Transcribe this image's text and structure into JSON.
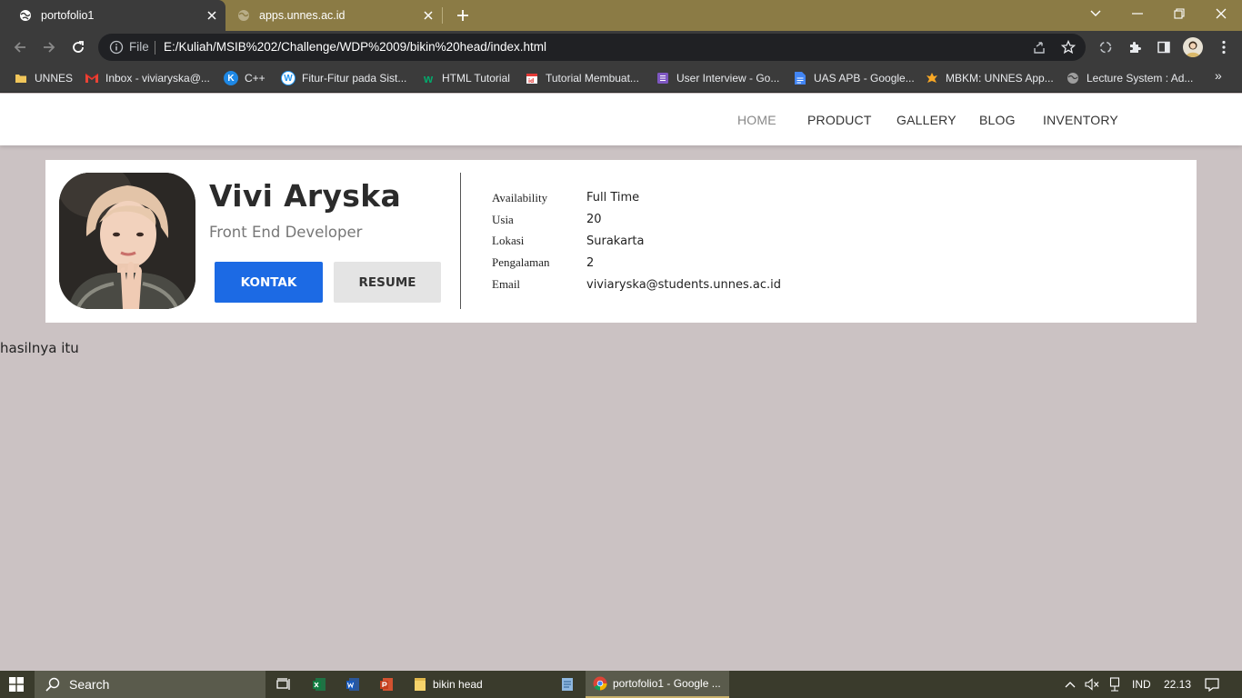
{
  "browser": {
    "tabs": [
      {
        "title": "portofolio1",
        "active": true
      },
      {
        "title": "apps.unnes.ac.id",
        "active": false
      }
    ],
    "omnibox": {
      "scheme_label": "File",
      "url": "E:/Kuliah/MSIB%202/Challenge/WDP%2009/bikin%20head/index.html"
    },
    "bookmarks": [
      {
        "label": "UNNES",
        "icon": "folder-icon",
        "color": "#f1c65a"
      },
      {
        "label": "Inbox - viviaryska@...",
        "icon": "gmail-icon",
        "color": "#ea4335"
      },
      {
        "label": "C++",
        "icon": "k-logo-icon",
        "color": "#1e88e5"
      },
      {
        "label": "Fitur-Fitur pada Sist...",
        "icon": "wordpress-icon",
        "color": "#2196f3"
      },
      {
        "label": "HTML Tutorial",
        "icon": "w3schools-icon",
        "color": "#04aa6d"
      },
      {
        "label": "Tutorial Membuat...",
        "icon": "calendar-icon",
        "color": "#e53935"
      },
      {
        "label": "User Interview - Go...",
        "icon": "forms-icon",
        "color": "#7e57c2"
      },
      {
        "label": "UAS APB - Google...",
        "icon": "docs-icon",
        "color": "#4285f4"
      },
      {
        "label": "MBKM: UNNES App...",
        "icon": "unnes-logo-icon",
        "color": "#f9a825"
      },
      {
        "label": "Lecture System : Ad...",
        "icon": "globe-icon",
        "color": "#9e9e9e"
      }
    ]
  },
  "site": {
    "nav": [
      {
        "label": "HOME",
        "active": true
      },
      {
        "label": "PRODUCT",
        "active": false
      },
      {
        "label": "GALLERY",
        "active": false
      },
      {
        "label": "BLOG",
        "active": false
      },
      {
        "label": "INVENTORY",
        "active": false
      }
    ],
    "profile": {
      "name": "Vivi Aryska",
      "role": "Front End Developer",
      "contact_button": "KONTAK",
      "resume_button": "RESUME",
      "details": [
        {
          "label": "Availability",
          "value": "Full Time"
        },
        {
          "label": "Usia",
          "value": "20"
        },
        {
          "label": "Lokasi",
          "value": "Surakarta"
        },
        {
          "label": "Pengalaman",
          "value": "2"
        },
        {
          "label": "Email",
          "value": "viviaryska@students.unnes.ac.id"
        }
      ]
    },
    "footnote": "hasilnya itu"
  },
  "taskbar": {
    "search_placeholder": "Search",
    "apps": [
      {
        "label": "bikin head",
        "icon": "folder-icon"
      },
      {
        "label": "portofolio1 - Google ...",
        "icon": "chrome-icon"
      }
    ],
    "tray": {
      "language": "IND",
      "time": "22.13"
    }
  },
  "colors": {
    "page_bg": "#cbc2c3",
    "primary_button": "#1c6ae4",
    "tabbar": "#8b7b45"
  }
}
